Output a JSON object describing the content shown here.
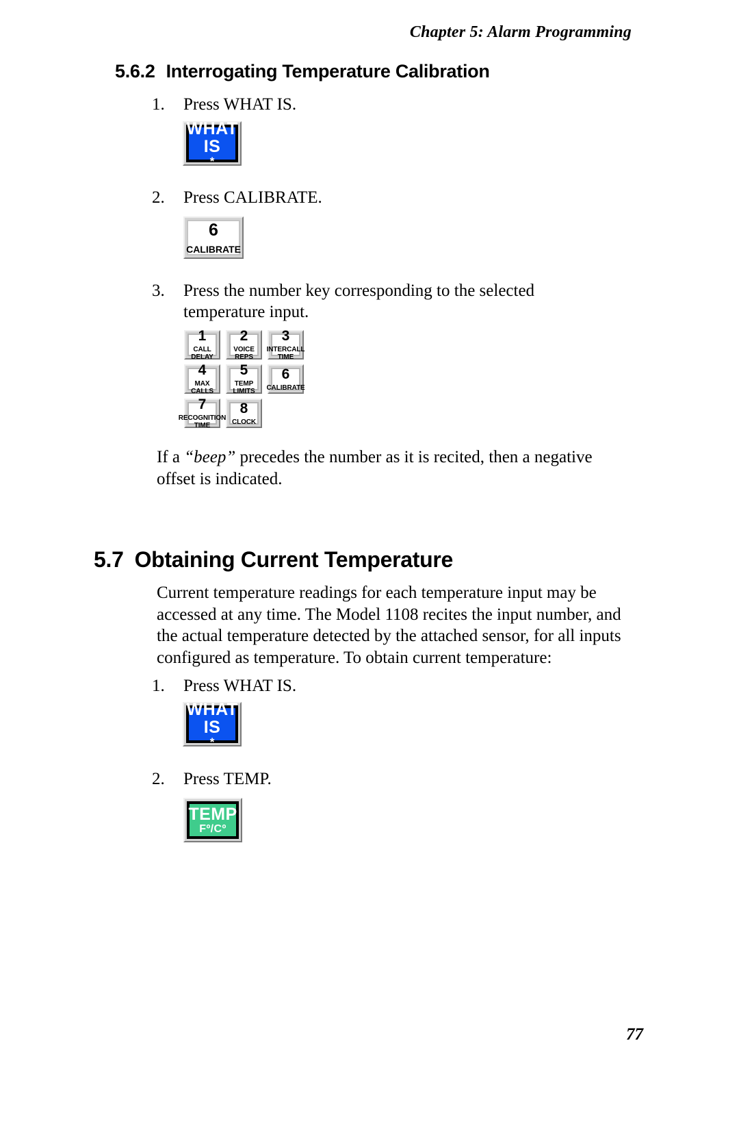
{
  "running_head": "Chapter 5: Alarm Programming",
  "section_562": {
    "number": "5.6.2",
    "title": "Interrogating Temperature Calibration",
    "steps": [
      {
        "marker": "1.",
        "text": "Press WHAT IS."
      },
      {
        "marker": "2.",
        "text": "Press CALIBRATE."
      },
      {
        "marker": "3.",
        "text": "Press the number key corresponding to the selected temperature input."
      }
    ],
    "note_prefix": "If a ",
    "note_emphasis": "“beep”",
    "note_suffix": " precedes the number as it is recited, then a negative offset is indicated."
  },
  "section_57": {
    "number": "5.7",
    "title": "Obtaining Current Temperature",
    "paragraph": "Current temperature readings for each temperature input may be accessed at any time. The Model 1108 recites the input number, and the actual temperature detected by the attached sensor, for all inputs configured as temperature. To obtain current temperature:",
    "steps": [
      {
        "marker": "1.",
        "text": "Press WHAT IS."
      },
      {
        "marker": "2.",
        "text": "Press TEMP."
      }
    ]
  },
  "keys": {
    "what_is": {
      "line1": "WHAT",
      "line2": "IS",
      "line3": "*",
      "color": "#0b53f0"
    },
    "calibrate": {
      "digit": "6",
      "label": "CALIBRATE"
    },
    "temp": {
      "line1": "TEMP",
      "line2": "Fº/Cº",
      "color": "#3fcc8c"
    },
    "keypad": [
      {
        "digit": "1",
        "label": "CALL\nDELAY"
      },
      {
        "digit": "2",
        "label": "VOICE\nREPS"
      },
      {
        "digit": "3",
        "label": "INTERCALL\nTIME"
      },
      {
        "digit": "4",
        "label": "MAX CALLS"
      },
      {
        "digit": "5",
        "label": "TEMP LIMITS"
      },
      {
        "digit": "6",
        "label": "CALIBRATE"
      },
      {
        "digit": "7",
        "label": "RECOGNITION\nTIME"
      },
      {
        "digit": "8",
        "label": "CLOCK"
      }
    ]
  },
  "page_number": "77"
}
